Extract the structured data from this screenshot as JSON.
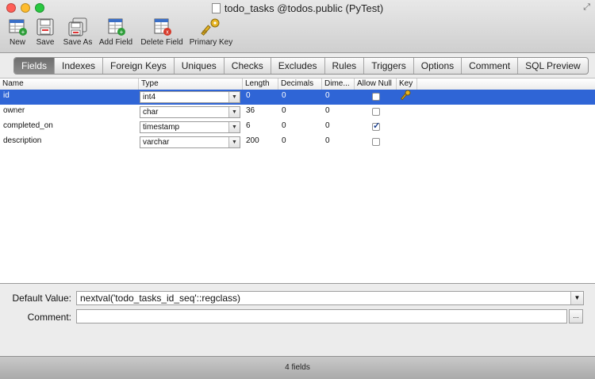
{
  "window": {
    "title": "todo_tasks @todos.public (PyTest)",
    "traffic_light_colors": [
      "#ff5f57",
      "#febc2e",
      "#28c840"
    ]
  },
  "toolbar": [
    {
      "label": "New",
      "icon": "new-table-icon"
    },
    {
      "label": "Save",
      "icon": "save-disk-icon"
    },
    {
      "label": "Save As",
      "icon": "save-as-icon"
    },
    {
      "label": "Add Field",
      "icon": "add-field-icon"
    },
    {
      "label": "Delete Field",
      "icon": "delete-field-icon"
    },
    {
      "label": "Primary Key",
      "icon": "key-icon"
    }
  ],
  "tabs": [
    "Fields",
    "Indexes",
    "Foreign Keys",
    "Uniques",
    "Checks",
    "Excludes",
    "Rules",
    "Triggers",
    "Options",
    "Comment",
    "SQL Preview"
  ],
  "active_tab": "Fields",
  "grid": {
    "columns": [
      "Name",
      "Type",
      "Length",
      "Decimals",
      "Dime...",
      "Allow Null",
      "Key"
    ],
    "rows": [
      {
        "name": "id",
        "type": "int4",
        "length": "0",
        "decimals": "0",
        "dim": "0",
        "allow_null": false,
        "key": true,
        "selected": true
      },
      {
        "name": "owner",
        "type": "char",
        "length": "36",
        "decimals": "0",
        "dim": "0",
        "allow_null": false,
        "key": false,
        "selected": false
      },
      {
        "name": "completed_on",
        "type": "timestamp",
        "length": "6",
        "decimals": "0",
        "dim": "0",
        "allow_null": true,
        "key": false,
        "selected": false
      },
      {
        "name": "description",
        "type": "varchar",
        "length": "200",
        "decimals": "0",
        "dim": "0",
        "allow_null": false,
        "key": false,
        "selected": false
      }
    ]
  },
  "details": {
    "default_label": "Default Value:",
    "default_value": "nextval('todo_tasks_id_seq'::regclass)",
    "comment_label": "Comment:",
    "comment_value": "",
    "comment_button": "..."
  },
  "status": "4 fields",
  "colors": {
    "selection": "#2f65d6",
    "accent": "#2f65d6"
  }
}
